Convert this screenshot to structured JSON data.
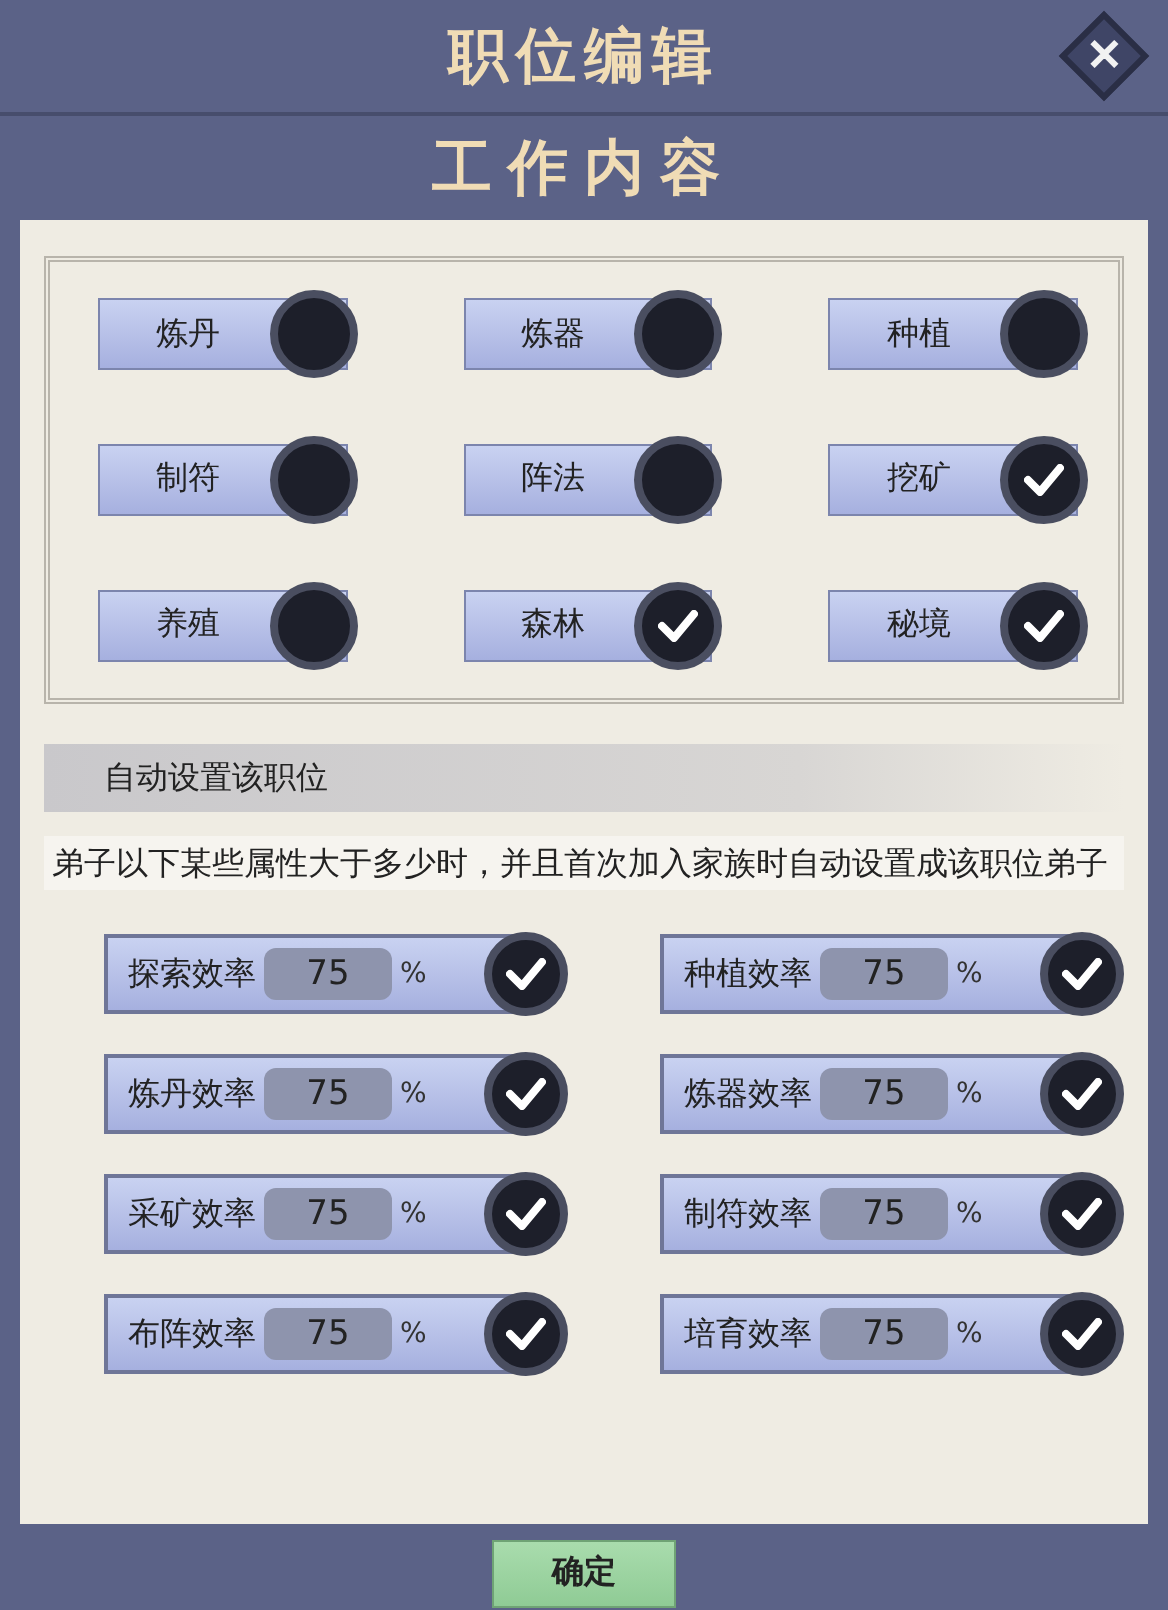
{
  "window": {
    "title": "职位编辑",
    "close": "✕"
  },
  "section_title": "工作内容",
  "jobs": [
    {
      "label": "炼丹",
      "checked": false
    },
    {
      "label": "炼器",
      "checked": false
    },
    {
      "label": "种植",
      "checked": false
    },
    {
      "label": "制符",
      "checked": false
    },
    {
      "label": "阵法",
      "checked": false
    },
    {
      "label": "挖矿",
      "checked": true
    },
    {
      "label": "养殖",
      "checked": false
    },
    {
      "label": "森林",
      "checked": true
    },
    {
      "label": "秘境",
      "checked": true
    }
  ],
  "auto": {
    "title": "自动设置该职位",
    "description": "弟子以下某些属性大于多少时，并且首次加入家族时自动设置成该职位弟子"
  },
  "attributes": [
    {
      "label": "探索效率",
      "value": "75",
      "unit": "%",
      "checked": true
    },
    {
      "label": "种植效率",
      "value": "75",
      "unit": "%",
      "checked": true
    },
    {
      "label": "炼丹效率",
      "value": "75",
      "unit": "%",
      "checked": true
    },
    {
      "label": "炼器效率",
      "value": "75",
      "unit": "%",
      "checked": true
    },
    {
      "label": "采矿效率",
      "value": "75",
      "unit": "%",
      "checked": true
    },
    {
      "label": "制符效率",
      "value": "75",
      "unit": "%",
      "checked": true
    },
    {
      "label": "布阵效率",
      "value": "75",
      "unit": "%",
      "checked": true
    },
    {
      "label": "培育效率",
      "value": "75",
      "unit": "%",
      "checked": true
    }
  ],
  "confirm": "确定"
}
